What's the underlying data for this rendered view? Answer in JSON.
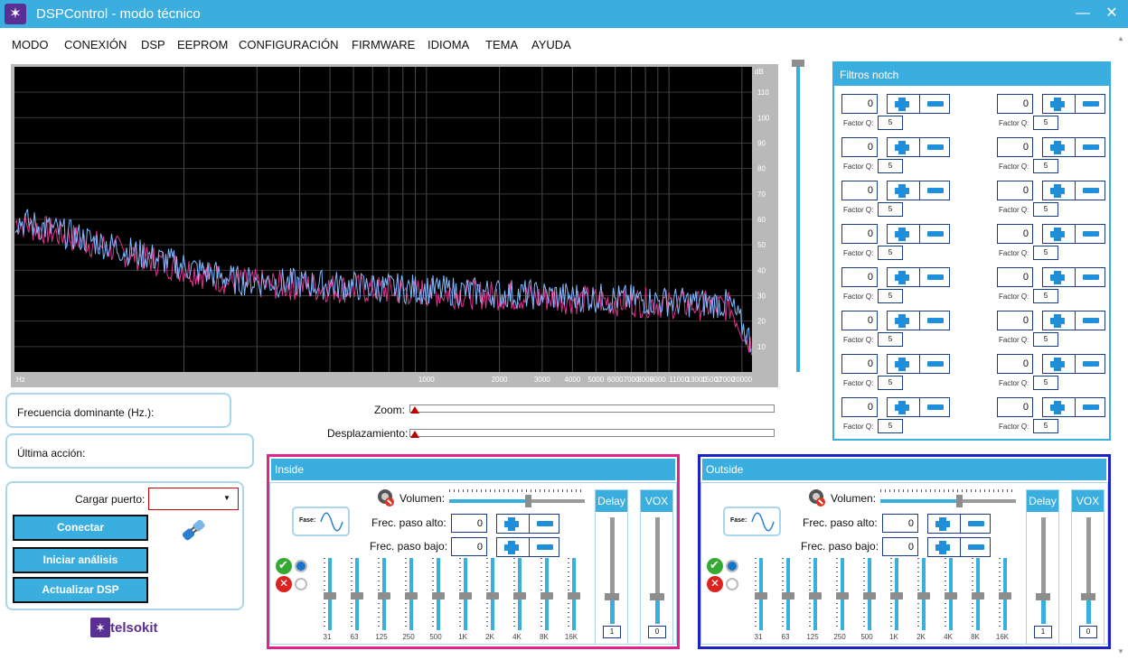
{
  "window": {
    "title": "DSPControl - modo técnico",
    "minimize": "—",
    "close": "✕"
  },
  "menu": [
    "MODO",
    "CONEXIÓN",
    "DSP",
    "EEPROM",
    "CONFIGURACIÓN",
    "FIRMWARE",
    "IDIOMA",
    "TEMA",
    "AYUDA"
  ],
  "spectrum": {
    "y_unit": "dB",
    "y_ticks": [
      "110",
      "100",
      "90",
      "80",
      "70",
      "60",
      "50",
      "40",
      "30",
      "20",
      "10"
    ],
    "x_unit": "Hz",
    "x_ticks": [
      "1000",
      "2000",
      "3000",
      "4000",
      "5000",
      "6000",
      "7000",
      "8000",
      "9000",
      "11000",
      "13000",
      "15000",
      "17000",
      "20000"
    ],
    "series_colors": [
      "#7fb9ff",
      "#e0348e"
    ]
  },
  "info": {
    "freq_label": "Frecuencia dominante (Hz.):",
    "last_action_label": "Última acción:"
  },
  "zoom": {
    "zoom_label": "Zoom:",
    "pan_label": "Desplazamiento:"
  },
  "connection": {
    "port_label": "Cargar puerto:",
    "port_value": "",
    "connect": "Conectar",
    "start": "Iniciar análisis",
    "update": "Actualizar DSP"
  },
  "brand": "telsokit",
  "notch": {
    "title": "Filtros notch",
    "q_label": "Factor Q:",
    "filters": [
      {
        "value": "0",
        "q": "5"
      },
      {
        "value": "0",
        "q": "5"
      },
      {
        "value": "0",
        "q": "5"
      },
      {
        "value": "0",
        "q": "5"
      },
      {
        "value": "0",
        "q": "5"
      },
      {
        "value": "0",
        "q": "5"
      },
      {
        "value": "0",
        "q": "5"
      },
      {
        "value": "0",
        "q": "5"
      },
      {
        "value": "0",
        "q": "5"
      },
      {
        "value": "0",
        "q": "5"
      },
      {
        "value": "0",
        "q": "5"
      },
      {
        "value": "0",
        "q": "5"
      },
      {
        "value": "0",
        "q": "5"
      },
      {
        "value": "0",
        "q": "5"
      },
      {
        "value": "0",
        "q": "5"
      },
      {
        "value": "0",
        "q": "5"
      }
    ]
  },
  "inside": {
    "title": "Inside",
    "volume_label": "Volumen:",
    "phase_label": "Fase:",
    "hp_label": "Frec. paso alto:",
    "hp_value": "0",
    "lp_label": "Frec. paso bajo:",
    "lp_value": "0",
    "delay_label": "Delay",
    "delay_value": "1",
    "vox_label": "VOX",
    "vox_value": "0",
    "accent": "#e0248c"
  },
  "outside": {
    "title": "Outside",
    "volume_label": "Volumen:",
    "phase_label": "Fase:",
    "hp_label": "Frec. paso alto:",
    "hp_value": "0",
    "lp_label": "Frec. paso bajo:",
    "lp_value": "0",
    "delay_label": "Delay",
    "delay_value": "1",
    "vox_label": "VOX",
    "vox_value": "0",
    "accent": "#1a22c8"
  },
  "eq_bands": [
    "31",
    "63",
    "125",
    "250",
    "500",
    "1K",
    "2K",
    "4K",
    "8K",
    "16K"
  ]
}
